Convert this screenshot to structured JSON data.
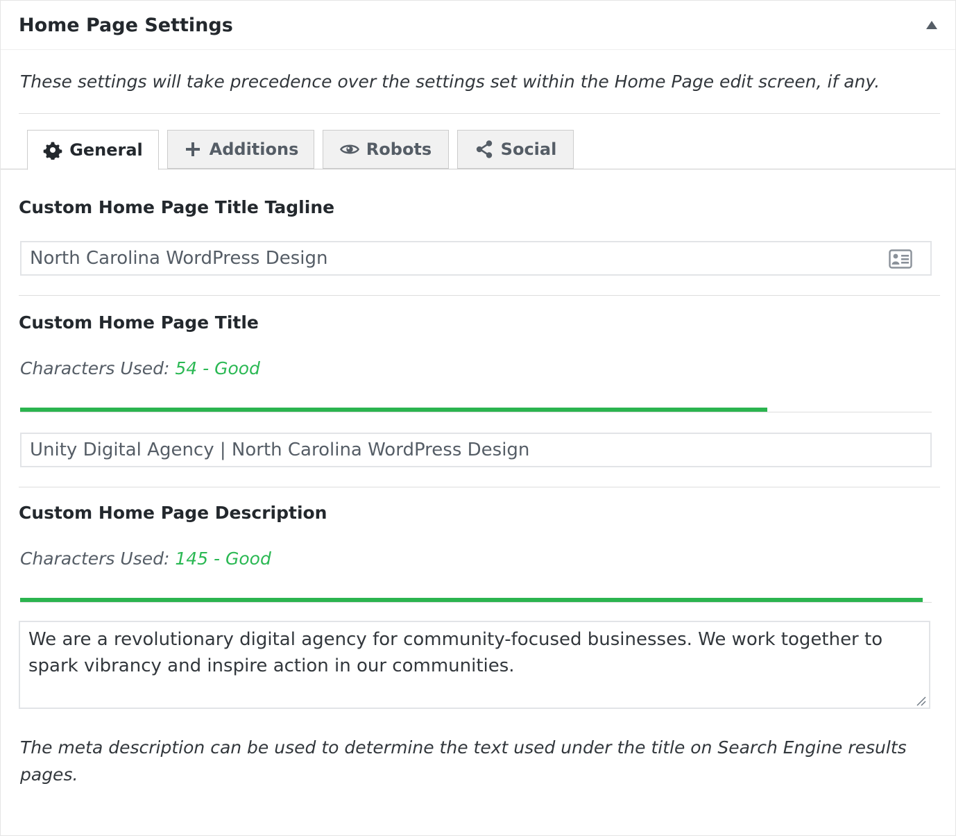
{
  "panel": {
    "title": "Home Page Settings",
    "intro": "These settings will take precedence over the settings set within the Home Page edit screen, if any."
  },
  "tabs": [
    {
      "label": "General",
      "icon": "gear-icon",
      "active": true
    },
    {
      "label": "Additions",
      "icon": "plus-icon",
      "active": false
    },
    {
      "label": "Robots",
      "icon": "eye-icon",
      "active": false
    },
    {
      "label": "Social",
      "icon": "share-icon",
      "active": false
    }
  ],
  "tagline": {
    "label": "Custom Home Page Title Tagline",
    "value": "North Carolina WordPress Design",
    "icon": "id-card-icon"
  },
  "title_field": {
    "label": "Custom Home Page Title",
    "counter_prefix": "Characters Used:",
    "counter_value": "54 - Good",
    "progress_fraction": 0.82,
    "value": "Unity Digital Agency | North Carolina WordPress Design"
  },
  "description_field": {
    "label": "Custom Home Page Description",
    "counter_prefix": "Characters Used:",
    "counter_value": "145 - Good",
    "progress_fraction": 0.99,
    "value": "We are a revolutionary digital agency for community-focused businesses. We work together to spark vibrancy and inspire action in our communities.",
    "help": "The meta description can be used to determine the text used under the title on Search Engine results pages."
  },
  "colors": {
    "good": "#2bb44f",
    "text": "#23282d",
    "muted": "#555d66"
  }
}
